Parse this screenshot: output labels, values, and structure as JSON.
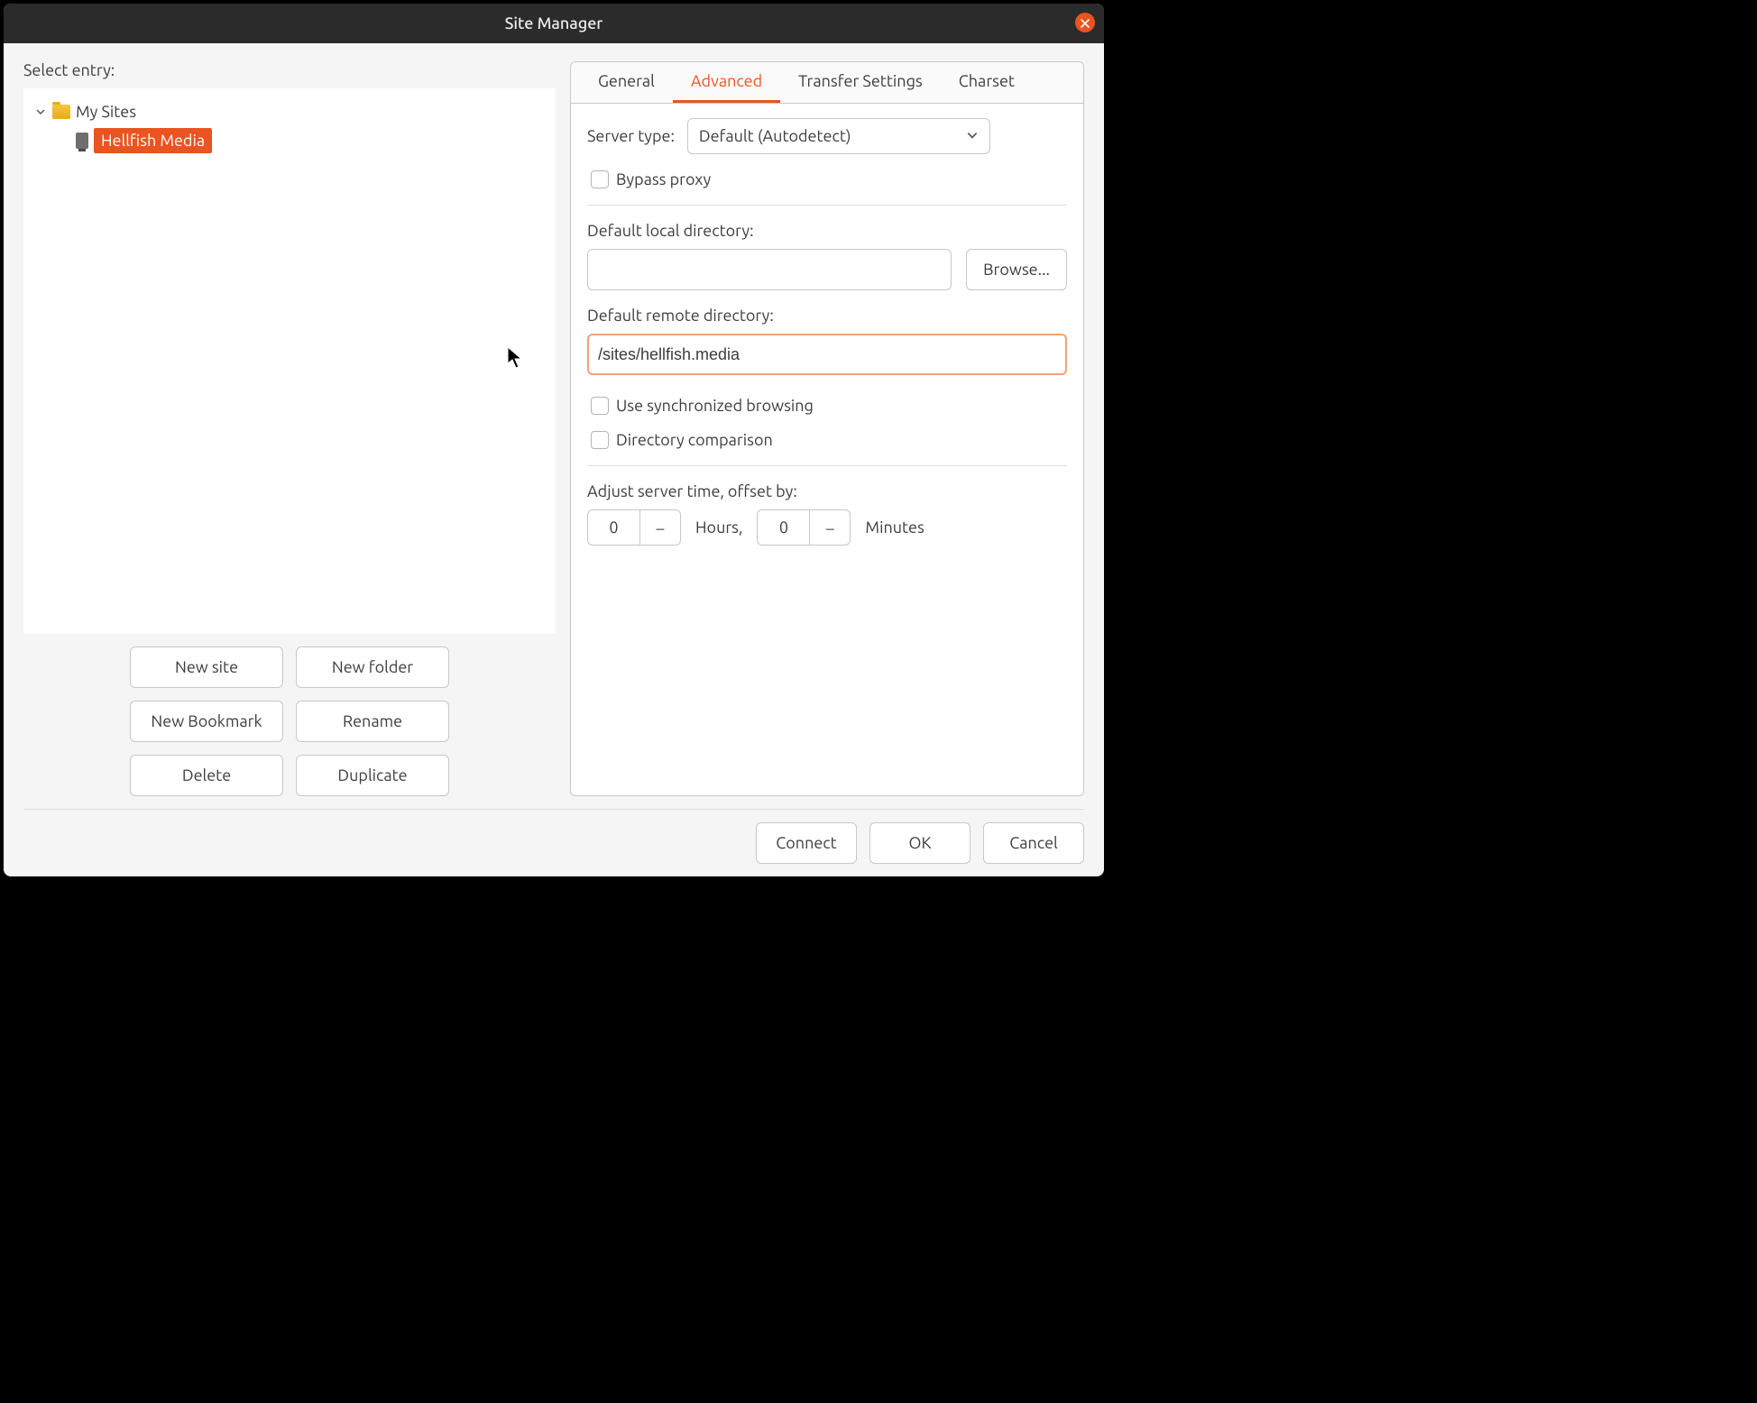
{
  "window": {
    "title": "Site Manager"
  },
  "left": {
    "select_entry": "Select entry:",
    "tree": {
      "root": "My Sites",
      "site": "Hellfish Media"
    },
    "buttons": {
      "new_site": "New site",
      "new_folder": "New folder",
      "new_bookmark": "New Bookmark",
      "rename": "Rename",
      "delete": "Delete",
      "duplicate": "Duplicate"
    }
  },
  "tabs": {
    "general": "General",
    "advanced": "Advanced",
    "transfer": "Transfer Settings",
    "charset": "Charset"
  },
  "advanced": {
    "server_type_label": "Server type:",
    "server_type_value": "Default (Autodetect)",
    "bypass_proxy": "Bypass proxy",
    "local_dir_label": "Default local directory:",
    "local_dir_value": "",
    "browse": "Browse...",
    "remote_dir_label": "Default remote directory:",
    "remote_dir_value": "/sites/hellfish.media",
    "sync_browsing": "Use synchronized browsing",
    "dir_compare": "Directory comparison",
    "adjust_time_label": "Adjust server time, offset by:",
    "hours_value": "0",
    "hours_label": "Hours,",
    "minutes_value": "0",
    "minutes_label": "Minutes"
  },
  "footer": {
    "connect": "Connect",
    "ok": "OK",
    "cancel": "Cancel"
  }
}
